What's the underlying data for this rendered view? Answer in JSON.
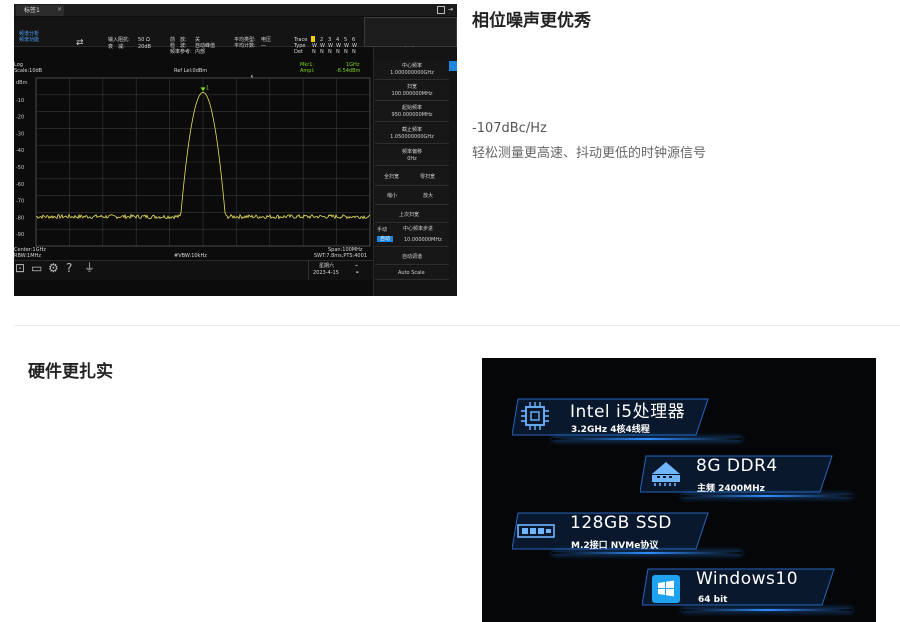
{
  "instrument": {
    "tab": "标签1",
    "mode_line1": "频谱分析",
    "mode_line2": "频谱功能",
    "params": {
      "input_imp_label": "输入阻抗:",
      "input_imp_value": "50 Ω",
      "atten_label": "衰　减:",
      "atten_value": "20dB",
      "preamp_label": "前　放:",
      "preamp_value": "关",
      "detector_label": "检　波:",
      "detector_value": "自动峰值",
      "freq_ref_label": "频率参考:",
      "freq_ref_value": "内部",
      "avg_type_label": "平均类型:",
      "avg_type_value": "电压",
      "avg_count_label": "平均计数:",
      "avg_count_value": "—"
    },
    "trace": {
      "label_trace": "Trace",
      "label_type": "Type",
      "label_det": "Det",
      "nums": [
        "1",
        "2",
        "3",
        "4",
        "5",
        "6"
      ],
      "types": [
        "W",
        "W",
        "W",
        "W",
        "W",
        "W"
      ],
      "dets": [
        "N",
        "N",
        "N",
        "N",
        "N",
        "N"
      ]
    },
    "top_right_button": "频率",
    "display": {
      "log": "Log",
      "scale": "Scale:10dB",
      "ref": "Ref Lel:0dBm",
      "marker_freq_label": "Mkr1:",
      "marker_freq_value": "1GHz",
      "marker_ampl_label": "Ampl:",
      "marker_ampl_value": "-8.54dBm",
      "y_ticks": [
        "dBm",
        "-10",
        "-20",
        "-30",
        "-40",
        "-50",
        "-60",
        "-70",
        "-80",
        "-90"
      ],
      "marker_num": "1",
      "center": "Center:1GHz",
      "rbw": "RBW:1MHz",
      "vbw": "#VBW:10kHz",
      "span": "Span:100MHz",
      "swt": "SWT:7.8ms,PTS:4001"
    },
    "status": {
      "weekday": "星期六",
      "date": "2023-4-15"
    },
    "side_tab": "频率",
    "menu": [
      {
        "label": "中心频率",
        "value": "1.000000000GHz"
      },
      {
        "label": "扫宽",
        "value": "100.000000MHz"
      },
      {
        "label": "起始频率",
        "value": "950.000000MHz"
      },
      {
        "label": "截止频率",
        "value": "1.050000000GHz"
      },
      {
        "label": "频率偏移",
        "value": "0Hz"
      }
    ],
    "menu_pairs": [
      {
        "left": "全扫宽",
        "right": "零扫宽"
      },
      {
        "left": "缩小",
        "right": "放大"
      }
    ],
    "last_span": "上次扫宽",
    "step": {
      "label": "中心频率步进",
      "manual": "手动",
      "auto": "自动",
      "value": "10.000000MHz"
    },
    "auto_tune": "自动调谐",
    "auto_scale": "Auto Scale"
  },
  "section1": {
    "title": "相位噪声更优秀",
    "spec": "-107dBc/Hz",
    "desc": "轻松测量更高速、抖动更低的时钟源信号"
  },
  "section2": {
    "title": "硬件更扎实"
  },
  "hardware": [
    {
      "title": "Intel i5处理器",
      "sub": "3.2GHz  4核4线程",
      "icon": "cpu-icon"
    },
    {
      "title": "8G DDR4",
      "sub": "主频 2400MHz",
      "icon": "ram-icon"
    },
    {
      "title": "128GB SSD",
      "sub": "M.2接口 NVMe协议",
      "icon": "ssd-icon"
    },
    {
      "title": "Windows10",
      "sub": "64 bit",
      "icon": "windows-icon"
    }
  ],
  "colors": {
    "trace": "#e8e05a",
    "accent_blue": "#1f86e0",
    "marker_green": "#7ed321",
    "hardware_glow": "#2f8dff"
  }
}
